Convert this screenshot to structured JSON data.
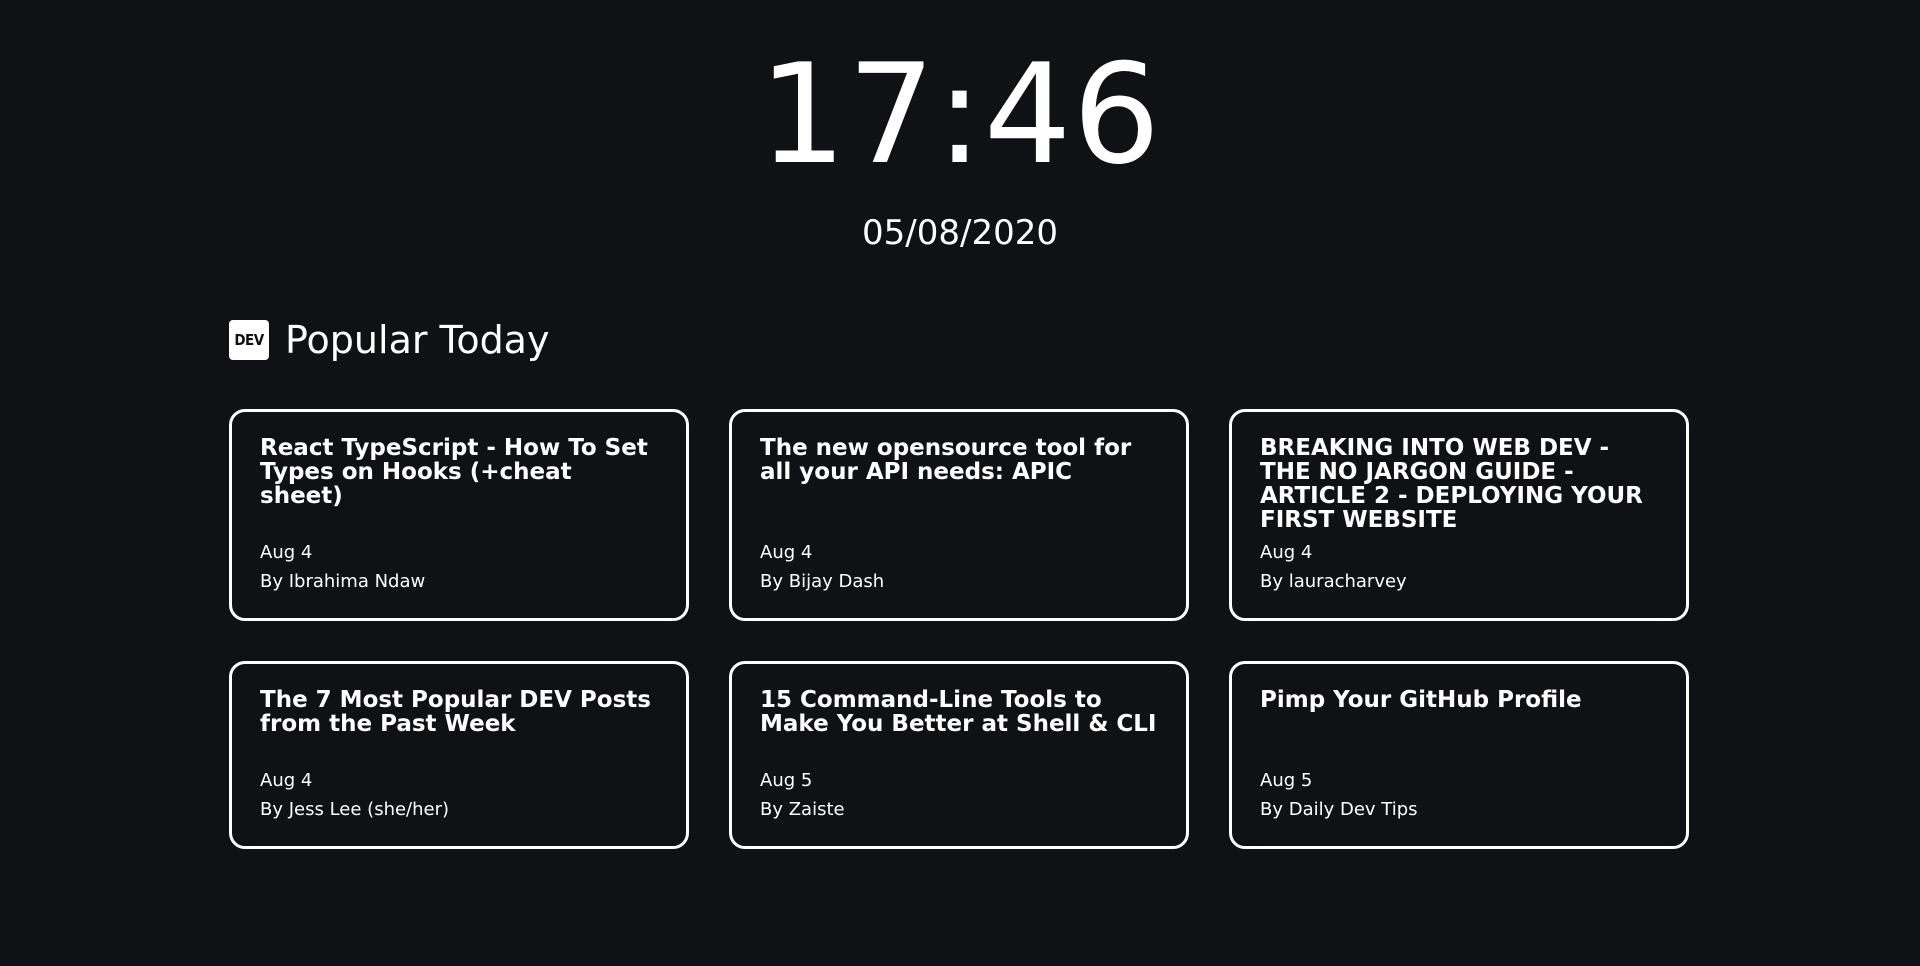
{
  "clock": {
    "time": "17:46",
    "date": "05/08/2020"
  },
  "section": {
    "logo_text": "DEV",
    "title": "Popular Today"
  },
  "articles": [
    {
      "title": "React TypeScript - How To Set Types on Hooks (+cheat sheet)",
      "date": "Aug 4",
      "author": "By Ibrahima Ndaw"
    },
    {
      "title": "The new opensource tool for all your API needs: APIC",
      "date": "Aug 4",
      "author": "By Bijay Dash"
    },
    {
      "title": "BREAKING INTO WEB DEV - THE NO JARGON GUIDE - ARTICLE 2 - DEPLOYING YOUR FIRST WEBSITE",
      "date": "Aug 4",
      "author": "By lauracharvey"
    },
    {
      "title": "The 7 Most Popular DEV Posts from the Past Week",
      "date": "Aug 4",
      "author": "By Jess Lee (she/her)"
    },
    {
      "title": "15 Command-Line Tools to Make You Better at Shell & CLI",
      "date": "Aug 5",
      "author": "By Zaiste"
    },
    {
      "title": "Pimp Your GitHub Profile",
      "date": "Aug 5",
      "author": "By Daily Dev Tips"
    }
  ]
}
